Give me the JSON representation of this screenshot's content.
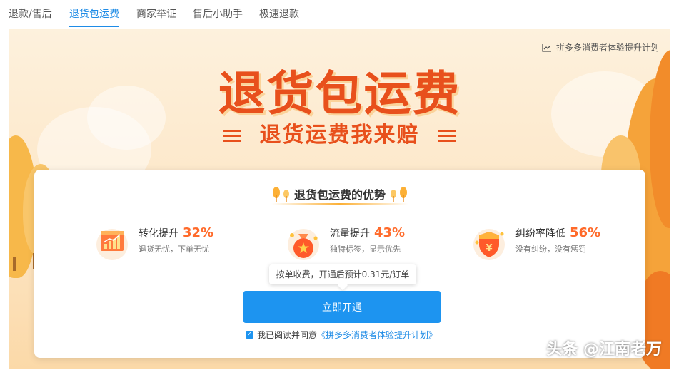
{
  "tabs": [
    {
      "label": "退款/售后"
    },
    {
      "label": "退货包运费"
    },
    {
      "label": "商家举证"
    },
    {
      "label": "售后小助手"
    },
    {
      "label": "极速退款"
    }
  ],
  "banner": {
    "plan_link": "拼多多消费者体验提升计划",
    "title": "退货包运费",
    "subtitle": "退货运费我来赔"
  },
  "card": {
    "title": "退货包运费的优势",
    "advantages": [
      {
        "name": "转化提升",
        "percent": "32%",
        "desc": "退货无忧，下单无忧",
        "icon": "chart-up-icon"
      },
      {
        "name": "流量提升",
        "percent": "43%",
        "desc": "独特标签，显示优先",
        "icon": "money-bag-icon"
      },
      {
        "name": "纠纷率降低",
        "percent": "56%",
        "desc": "没有纠纷，没有惩罚",
        "icon": "shield-yen-icon"
      }
    ],
    "tooltip": "按单收费，开通后预计0.31元/订单",
    "button": "立即开通",
    "agree_prefix": "我已阅读并同意",
    "agree_link": "《拼多多消费者体验提升计划》",
    "agree_checked": true
  },
  "watermark": "头条 @江南老万",
  "colors": {
    "accent": "#1d94f0",
    "title_orange": "#e8501c",
    "percent_orange": "#ff6a2a"
  }
}
